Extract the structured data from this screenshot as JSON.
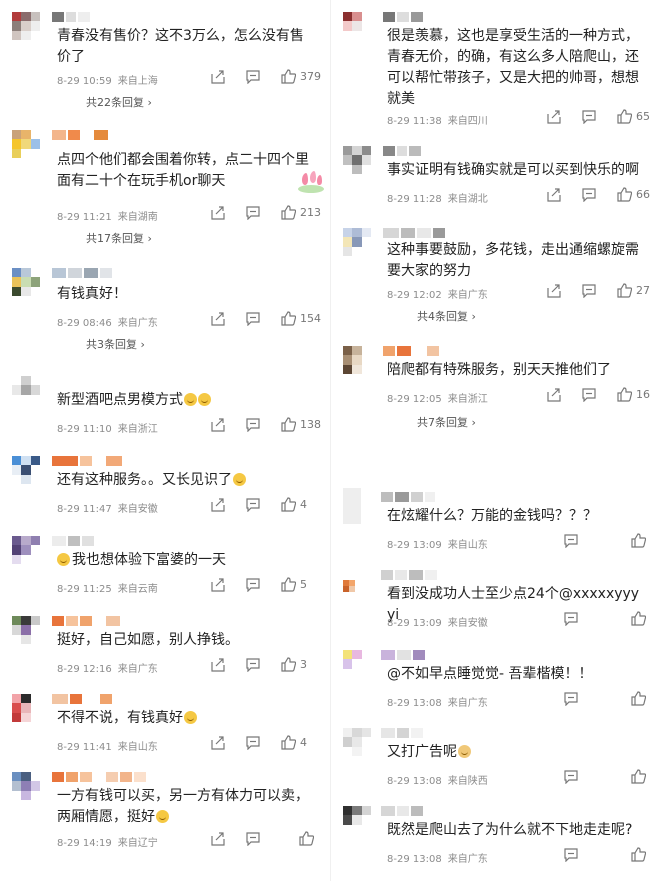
{
  "comments_left": [
    {
      "text": "青春没有售价？这不3万么，怎么没有售价了",
      "time": "8-29 10:59",
      "location": "来自上海",
      "likes": "379",
      "replies": "共22条回复"
    },
    {
      "text": "点四个他们都会围着你转，点二十四个里面有二十个在玩手机or聊天",
      "time": "8-29 11:21",
      "location": "来自湖南",
      "likes": "213",
      "replies": "共17条回复"
    },
    {
      "text": "有钱真好！",
      "time": "8-29 08:46",
      "location": "来自广东",
      "likes": "154",
      "replies": "共3条回复"
    },
    {
      "text": "新型酒吧点男模方式",
      "time": "8-29 11:10",
      "location": "来自浙江",
      "likes": "138",
      "replies": ""
    },
    {
      "text": "还有这种服务。。又长见识了",
      "time": "8-29 11:47",
      "location": "来自安徽",
      "likes": "4",
      "replies": ""
    },
    {
      "text": "我也想体验下富婆的一天",
      "time": "8-29 11:25",
      "location": "来自云南",
      "likes": "5",
      "replies": ""
    },
    {
      "text": "挺好，自己如愿，别人挣钱。",
      "time": "8-29 12:16",
      "location": "来自广东",
      "likes": "3",
      "replies": ""
    },
    {
      "text": "不得不说，有钱真好",
      "time": "8-29 11:41",
      "location": "来自山东",
      "likes": "4",
      "replies": ""
    },
    {
      "text": "一方有钱可以买，另一方有体力可以卖，两厢情愿，挺好",
      "time": "8-29 14:19",
      "location": "来自辽宁",
      "likes": "",
      "replies": ""
    }
  ],
  "comments_right": [
    {
      "text": "很是羡慕，这也是享受生活的一种方式，青春无价，的确，有这么多人陪爬山，还可以帮忙带孩子，又是大把的帅哥，想想就美",
      "time": "8-29 11:38",
      "location": "来自四川",
      "likes": "65",
      "replies": ""
    },
    {
      "text": "事实证明有钱确实就是可以买到快乐的啊",
      "time": "8-29 11:28",
      "location": "来自湖北",
      "likes": "66",
      "replies": ""
    },
    {
      "text": "这种事要鼓励，多花钱，走出通缩螺旋需要大家的努力",
      "time": "8-29 12:02",
      "location": "来自广东",
      "likes": "27",
      "replies": "共4条回复"
    },
    {
      "text": "陪爬都有特殊服务，别天天推他们了",
      "time": "8-29 12:05",
      "location": "来自浙江",
      "likes": "16",
      "replies": "共7条回复"
    },
    {
      "text": "在炫耀什么？万能的金钱吗？？？",
      "time": "8-29 13:09",
      "location": "来自山东",
      "likes": "",
      "replies": ""
    },
    {
      "text": "看到没成功人士至少点24个@xxxxxyyyyi",
      "time": "8-29 13:09",
      "location": "来自安徽",
      "likes": "",
      "replies": ""
    },
    {
      "text": "@不如早点睡觉觉- 吾辈楷模！！",
      "time": "8-29 13:08",
      "location": "来自广东",
      "likes": "",
      "replies": ""
    },
    {
      "text": "又打广告呢",
      "time": "8-29 13:08",
      "location": "来自陕西",
      "likes": "",
      "replies": ""
    },
    {
      "text": "既然是爬山去了为什么就不下地走走呢?",
      "time": "8-29 13:08",
      "location": "来自广东",
      "likes": "",
      "replies": ""
    }
  ],
  "icons": {
    "share": "share-icon",
    "comment": "comment-icon",
    "like": "thumbs-up-icon",
    "chevron": "chevron-right-icon"
  },
  "colors": {
    "text": "#222222",
    "meta": "#8c8c8c",
    "reply": "#555555",
    "emoji": "#f5c843"
  }
}
